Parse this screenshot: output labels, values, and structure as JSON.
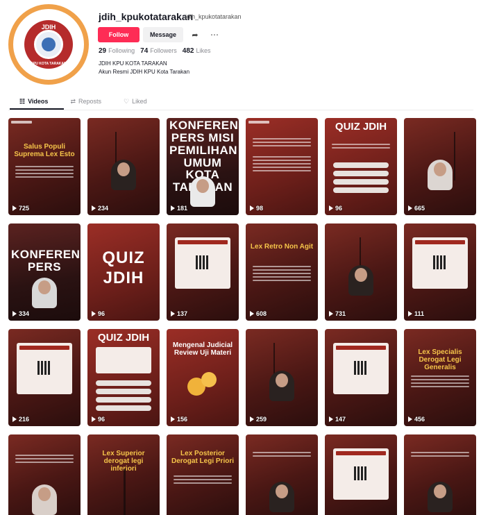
{
  "profile": {
    "username": "jdih_kpukotatarakan",
    "handle": "jdih_kpukotatarakan",
    "follow_label": "Follow",
    "message_label": "Message",
    "share_icon": "share-icon",
    "more_icon": "more-icon",
    "avatar": {
      "logo_text": "JDIH",
      "logo_sub": "KPU KOTA TARAKAN"
    },
    "stats": [
      {
        "value": "29",
        "label": "Following"
      },
      {
        "value": "74",
        "label": "Followers"
      },
      {
        "value": "482",
        "label": "Likes"
      }
    ],
    "bio_line1": "JDIH KPU KOTA TARAKAN",
    "bio_line2": "Akun Resmi JDIH KPU Kota Tarakan"
  },
  "tabs": [
    {
      "label": "Videos",
      "icon": "grid-icon"
    },
    {
      "label": "Reposts",
      "icon": "repost-icon"
    },
    {
      "label": "Liked",
      "icon": "heart-icon"
    }
  ],
  "videos": [
    {
      "views": "725",
      "title": "Salus Populi Suprema Lex Esto"
    },
    {
      "views": "234",
      "title": ""
    },
    {
      "views": "181",
      "title": "KONFERENSI PERS MISI PEMILIHAN UMUM KOTA TARAKAN"
    },
    {
      "views": "98",
      "title": ""
    },
    {
      "views": "96",
      "title": "QUIZ JDIH"
    },
    {
      "views": "665",
      "title": ""
    },
    {
      "views": "334",
      "title": "KONFERENSI PERS"
    },
    {
      "views": "96",
      "title": "QUIZ JDIH"
    },
    {
      "views": "137",
      "title": ""
    },
    {
      "views": "608",
      "title": "Lex Retro Non Agit"
    },
    {
      "views": "731",
      "title": ""
    },
    {
      "views": "111",
      "title": ""
    },
    {
      "views": "216",
      "title": ""
    },
    {
      "views": "96",
      "title": "QUIZ JDIH"
    },
    {
      "views": "156",
      "title": "Mengenal Judicial Review Uji Materi"
    },
    {
      "views": "259",
      "title": ""
    },
    {
      "views": "147",
      "title": ""
    },
    {
      "views": "456",
      "title": "Lex Specialis Derogat Legi Generalis"
    },
    {
      "views": "",
      "title": ""
    },
    {
      "views": "",
      "title": "Lex Superior derogat legi inferiori"
    },
    {
      "views": "",
      "title": "Lex Posterior Derogat Legi Priori"
    },
    {
      "views": "",
      "title": ""
    },
    {
      "views": "",
      "title": ""
    },
    {
      "views": "",
      "title": ""
    }
  ]
}
